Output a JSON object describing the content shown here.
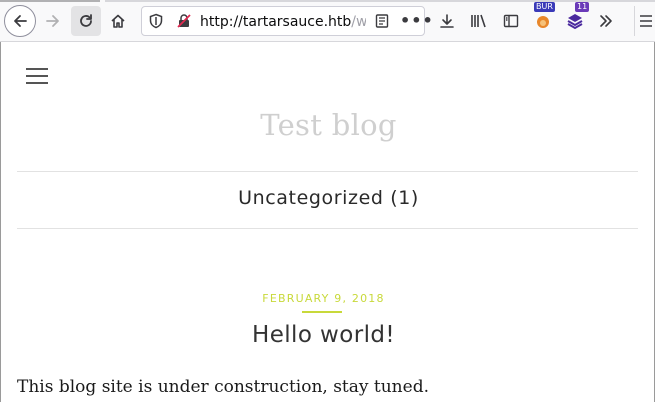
{
  "browser": {
    "url_host": "http://tartarsauce.htb",
    "url_rest": "/w",
    "extensions": {
      "burp_badge": "BUR",
      "ext_badge": "11"
    },
    "colors": {
      "toolbar_bg": "#f9f9fa",
      "accent": "#2b2f9e"
    }
  },
  "site": {
    "title": "Test blog",
    "category_link": "Uncategorized (1)",
    "post": {
      "date": "FEBRUARY 9, 2018",
      "title": "Hello world!",
      "body": "This blog site is under construction, stay tuned."
    },
    "colors": {
      "date_accent": "#c8d93a",
      "title_muted": "#cfcfcf"
    }
  },
  "icons": {
    "back": "arrow-left-icon",
    "forward": "arrow-right-icon",
    "reload": "reload-icon",
    "home": "home-icon",
    "tracking": "shield-icon",
    "insecure": "insecure-lock-icon",
    "reader": "reader-view-icon",
    "page_actions": "more-dots-icon",
    "downloads": "download-icon",
    "library": "library-icon",
    "sidebar": "sidebar-icon",
    "overflow": "chevrons-right-icon",
    "menu": "menu-icon"
  }
}
